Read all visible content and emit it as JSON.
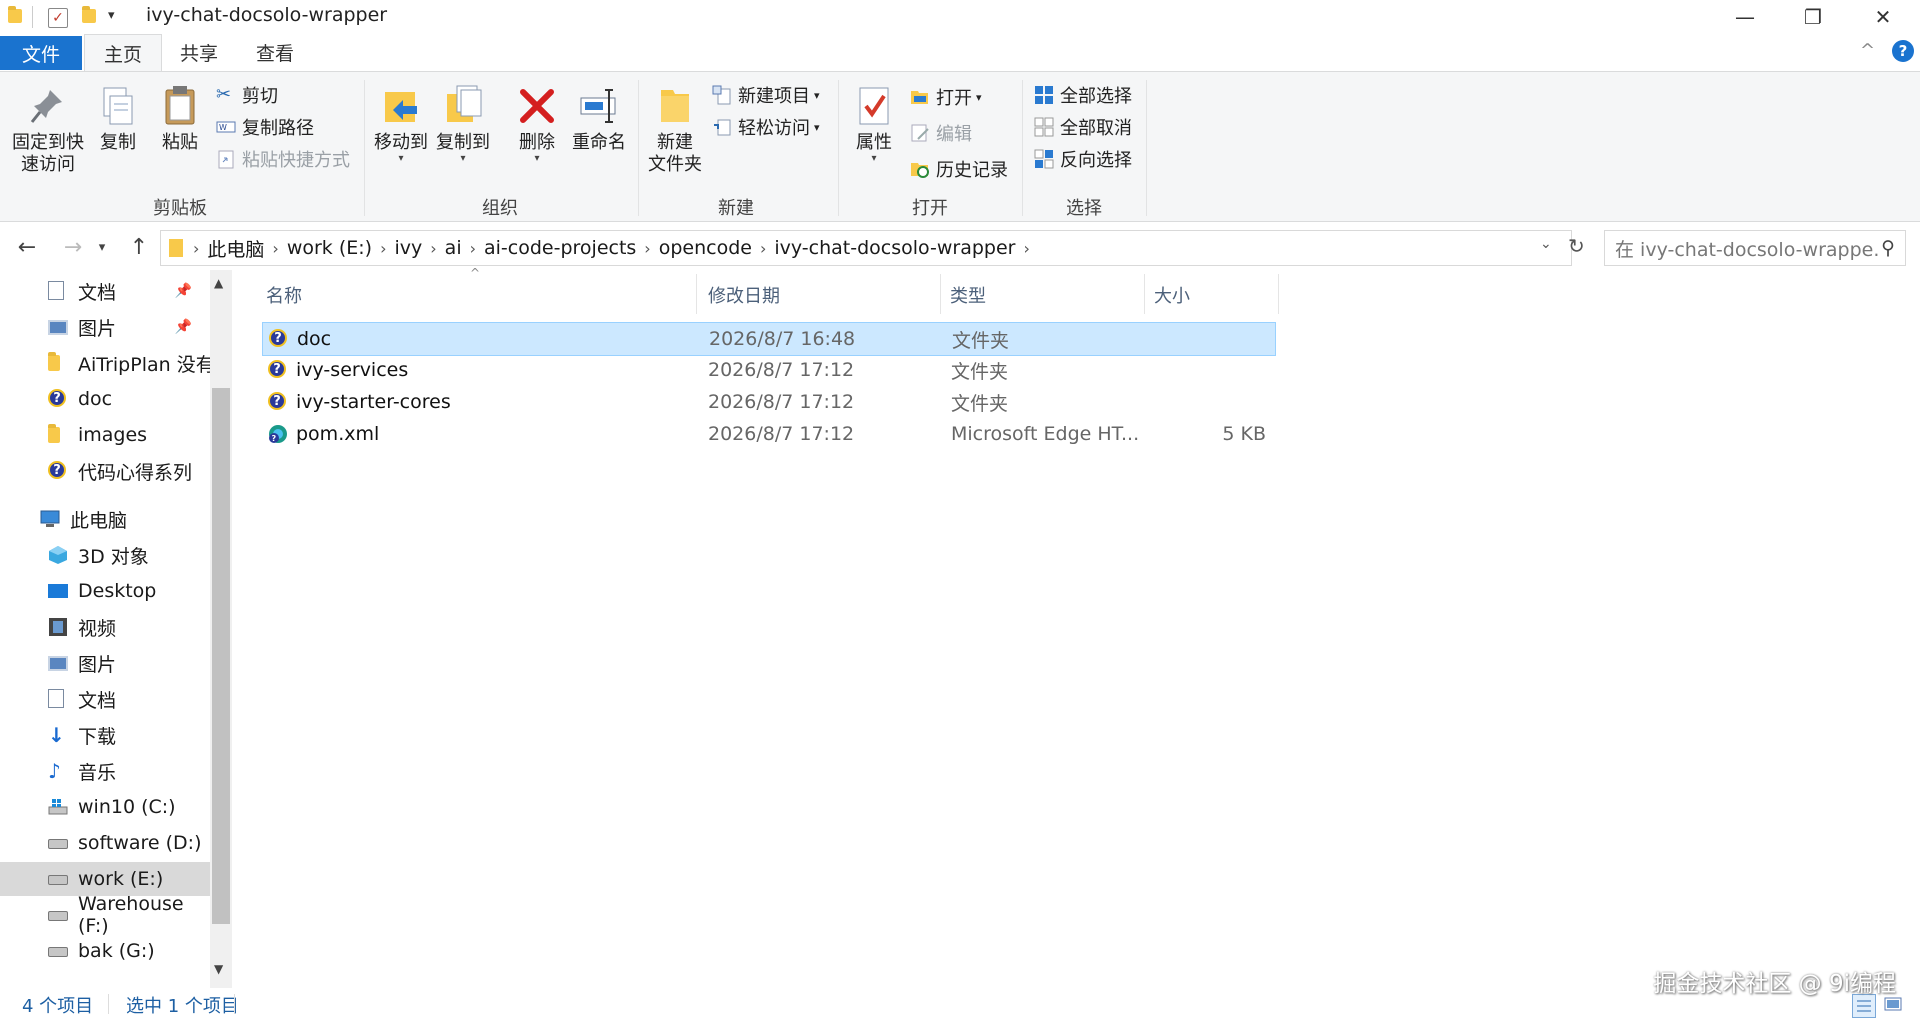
{
  "window": {
    "title": "ivy-chat-docsolo-wrapper",
    "minimize": "—",
    "maximize": "❐",
    "close": "✕",
    "collapse_ribbon": "^",
    "help": "?"
  },
  "tabs": {
    "file": "文件",
    "home": "主页",
    "share": "共享",
    "view": "查看"
  },
  "ribbon": {
    "clipboard": {
      "label": "剪贴板",
      "pin_quick": "固定到快\n速访问",
      "copy": "复制",
      "paste": "粘贴",
      "cut": "剪切",
      "copy_path": "复制路径",
      "paste_shortcut": "粘贴快捷方式"
    },
    "organize": {
      "label": "组织",
      "move_to": "移动到",
      "copy_to": "复制到",
      "delete": "删除",
      "rename": "重命名"
    },
    "new": {
      "label": "新建",
      "new_folder": "新建\n文件夹",
      "new_item": "新建项目",
      "easy_access": "轻松访问"
    },
    "open": {
      "label": "打开",
      "properties": "属性",
      "open": "打开",
      "edit": "编辑",
      "history": "历史记录"
    },
    "select": {
      "label": "选择",
      "select_all": "全部选择",
      "select_none": "全部取消",
      "invert": "反向选择"
    }
  },
  "address": {
    "crumbs": [
      "此电脑",
      "work (E:)",
      "ivy",
      "ai",
      "ai-code-projects",
      "opencode",
      "ivy-chat-docsolo-wrapper"
    ],
    "search_placeholder": "在 ivy-chat-docsolo-wrappe..."
  },
  "sidebar": {
    "quick": [
      {
        "label": "文档",
        "icon": "document-icon",
        "pinned": true
      },
      {
        "label": "图片",
        "icon": "picture-icon",
        "pinned": true
      },
      {
        "label": "AiTripPlan 没有",
        "icon": "folder-icon",
        "pinned": false
      },
      {
        "label": "doc",
        "icon": "unknown-folder-icon",
        "pinned": false
      },
      {
        "label": "images",
        "icon": "folder-icon",
        "pinned": false
      },
      {
        "label": "代码心得系列",
        "icon": "unknown-folder-icon",
        "pinned": false
      }
    ],
    "this_pc": "此电脑",
    "pc_items": [
      {
        "label": "3D 对象",
        "icon": "3d-objects-icon"
      },
      {
        "label": "Desktop",
        "icon": "desktop-icon"
      },
      {
        "label": "视频",
        "icon": "video-icon"
      },
      {
        "label": "图片",
        "icon": "picture-icon"
      },
      {
        "label": "文档",
        "icon": "document-icon"
      },
      {
        "label": "下载",
        "icon": "download-icon"
      },
      {
        "label": "音乐",
        "icon": "music-icon"
      },
      {
        "label": "win10 (C:)",
        "icon": "windows-drive-icon"
      },
      {
        "label": "software (D:)",
        "icon": "drive-icon"
      },
      {
        "label": "work (E:)",
        "icon": "drive-icon",
        "selected": true
      },
      {
        "label": "Warehouse (F:)",
        "icon": "drive-icon"
      },
      {
        "label": "bak (G:)",
        "icon": "drive-icon"
      }
    ]
  },
  "columns": {
    "name": "名称",
    "date": "修改日期",
    "type": "类型",
    "size": "大小"
  },
  "files": [
    {
      "name": "doc",
      "date": "2026/8/7 16:48",
      "type": "文件夹",
      "size": "",
      "icon": "unknown-folder-icon",
      "selected": true
    },
    {
      "name": "ivy-services",
      "date": "2026/8/7 17:12",
      "type": "文件夹",
      "size": "",
      "icon": "unknown-folder-icon"
    },
    {
      "name": "ivy-starter-cores",
      "date": "2026/8/7 17:12",
      "type": "文件夹",
      "size": "",
      "icon": "unknown-folder-icon"
    },
    {
      "name": "pom.xml",
      "date": "2026/8/7 17:12",
      "type": "Microsoft Edge HT...",
      "size": "5 KB",
      "icon": "edge-file-icon"
    }
  ],
  "status": {
    "count": "4 个项目",
    "selected": "选中 1 个项目"
  },
  "watermark": "掘金技术社区 @ 9i编程",
  "colors": {
    "accent": "#1a73cf",
    "selection": "#cce8ff",
    "ribbon_bg": "#f5f6f7"
  }
}
